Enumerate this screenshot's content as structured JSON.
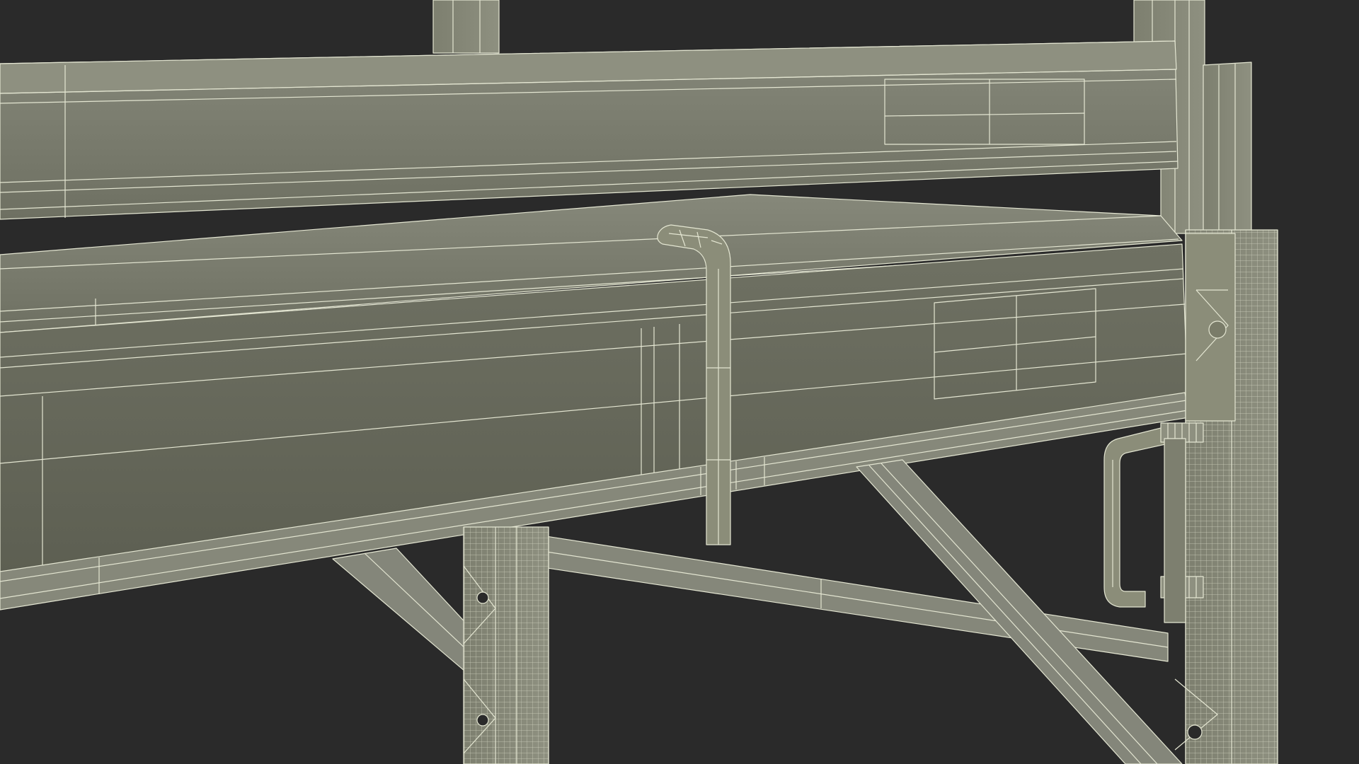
{
  "scene": {
    "subject": "wireframe-render-of-scaffold-platform-frame",
    "colors": {
      "background": "#2a2a2a",
      "surface_light": "#8b8d79",
      "surface_mid": "#7a7c69",
      "surface_dark": "#5f6152",
      "wire": "#e4e6d2"
    }
  }
}
